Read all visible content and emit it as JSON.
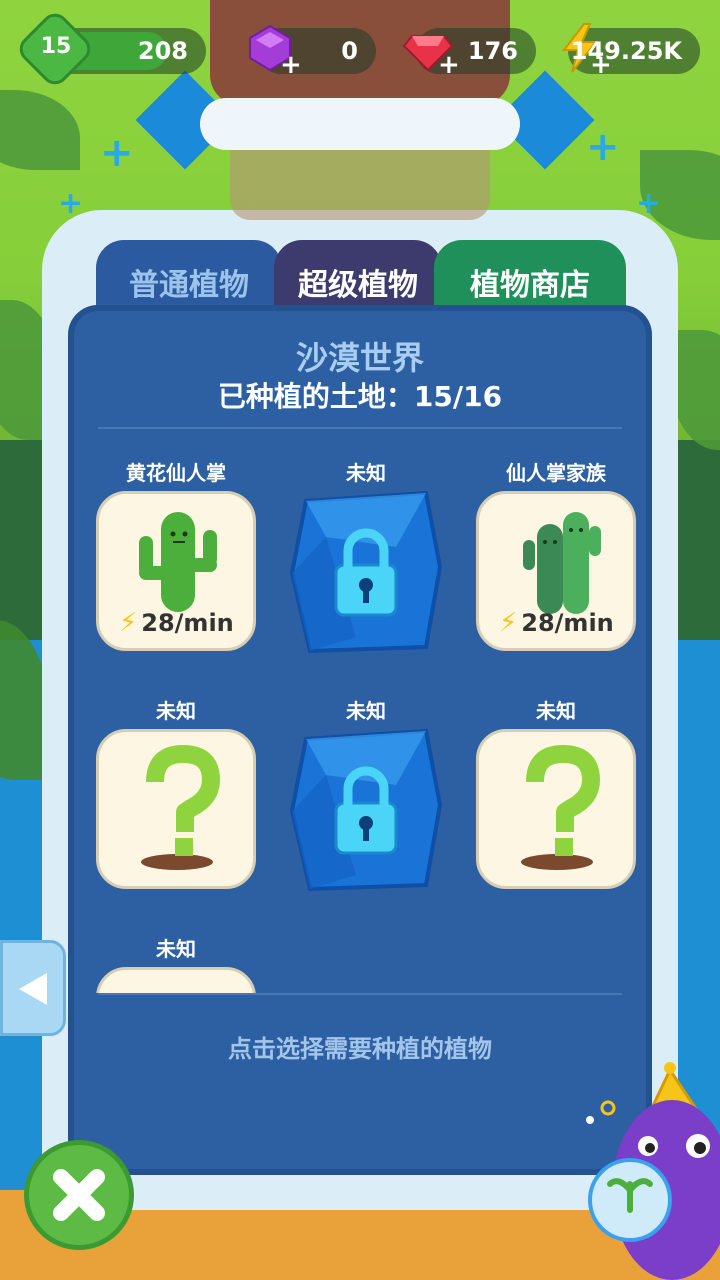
{
  "hud": {
    "level": "15",
    "xp": "208",
    "purple_gems": "0",
    "red_gems": "176",
    "energy": "149.25K"
  },
  "tabs": [
    {
      "label": "普通植物"
    },
    {
      "label": "超级植物"
    },
    {
      "label": "植物商店"
    }
  ],
  "panel": {
    "world_title": "沙漠世界",
    "land_text": "已种植的土地：15/16",
    "hint": "点击选择需要种植的植物"
  },
  "plants": [
    {
      "name": "黄花仙人掌",
      "state": "owned",
      "rate": "28/min",
      "icon": "cactus-icon"
    },
    {
      "name": "未知",
      "state": "locked",
      "icon": "lock-icon"
    },
    {
      "name": "仙人掌家族",
      "state": "owned",
      "rate": "28/min",
      "icon": "cactus-family-icon"
    },
    {
      "name": "未知",
      "state": "unknown",
      "icon": "question-mark-icon"
    },
    {
      "name": "未知",
      "state": "locked",
      "icon": "lock-icon"
    },
    {
      "name": "未知",
      "state": "unknown",
      "icon": "question-mark-icon"
    },
    {
      "name": "未知",
      "state": "unknown",
      "icon": "question-mark-icon"
    }
  ],
  "colors": {
    "panel": "#2d5fa3",
    "tab_normal": "#2c5aa0",
    "tab_super": "#3d3a6e",
    "tab_shop": "#20905a",
    "energy": "#f5c518"
  }
}
